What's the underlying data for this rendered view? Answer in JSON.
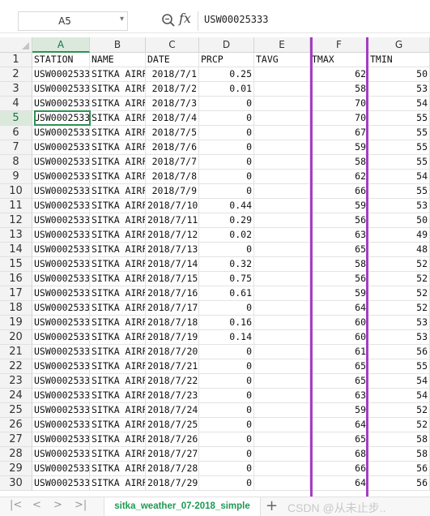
{
  "formula_bar": {
    "name_box": "A5",
    "fx_label": "fx",
    "content": "USW00025333"
  },
  "columns": [
    "A",
    "B",
    "C",
    "D",
    "E",
    "F",
    "G"
  ],
  "selected_column": "F",
  "rows": [
    {
      "n": "1",
      "A": "STATION",
      "B": "NAME",
      "C": "DATE",
      "D": "PRCP",
      "E": "TAVG",
      "F": "TMAX",
      "G": "TMIN"
    },
    {
      "n": "2",
      "A": "USW0002533",
      "B": "SITKA AIRF",
      "C": "2018/7/1",
      "D": "0.25",
      "E": "",
      "F": "62",
      "G": "50"
    },
    {
      "n": "3",
      "A": "USW0002533",
      "B": "SITKA AIRF",
      "C": "2018/7/2",
      "D": "0.01",
      "E": "",
      "F": "58",
      "G": "53"
    },
    {
      "n": "4",
      "A": "USW0002533",
      "B": "SITKA AIRF",
      "C": "2018/7/3",
      "D": "0",
      "E": "",
      "F": "70",
      "G": "54"
    },
    {
      "n": "5",
      "A": "USW0002533",
      "B": "SITKA AIRF",
      "C": "2018/7/4",
      "D": "0",
      "E": "",
      "F": "70",
      "G": "55"
    },
    {
      "n": "6",
      "A": "USW0002533",
      "B": "SITKA AIRF",
      "C": "2018/7/5",
      "D": "0",
      "E": "",
      "F": "67",
      "G": "55"
    },
    {
      "n": "7",
      "A": "USW0002533",
      "B": "SITKA AIRF",
      "C": "2018/7/6",
      "D": "0",
      "E": "",
      "F": "59",
      "G": "55"
    },
    {
      "n": "8",
      "A": "USW0002533",
      "B": "SITKA AIRF",
      "C": "2018/7/7",
      "D": "0",
      "E": "",
      "F": "58",
      "G": "55"
    },
    {
      "n": "9",
      "A": "USW0002533",
      "B": "SITKA AIRF",
      "C": "2018/7/8",
      "D": "0",
      "E": "",
      "F": "62",
      "G": "54"
    },
    {
      "n": "10",
      "A": "USW0002533",
      "B": "SITKA AIRF",
      "C": "2018/7/9",
      "D": "0",
      "E": "",
      "F": "66",
      "G": "55"
    },
    {
      "n": "11",
      "A": "USW0002533",
      "B": "SITKA AIRF",
      "C": "2018/7/10",
      "D": "0.44",
      "E": "",
      "F": "59",
      "G": "53"
    },
    {
      "n": "12",
      "A": "USW0002533",
      "B": "SITKA AIRF",
      "C": "2018/7/11",
      "D": "0.29",
      "E": "",
      "F": "56",
      "G": "50"
    },
    {
      "n": "13",
      "A": "USW0002533",
      "B": "SITKA AIRF",
      "C": "2018/7/12",
      "D": "0.02",
      "E": "",
      "F": "63",
      "G": "49"
    },
    {
      "n": "14",
      "A": "USW0002533",
      "B": "SITKA AIRF",
      "C": "2018/7/13",
      "D": "0",
      "E": "",
      "F": "65",
      "G": "48"
    },
    {
      "n": "15",
      "A": "USW0002533",
      "B": "SITKA AIRF",
      "C": "2018/7/14",
      "D": "0.32",
      "E": "",
      "F": "58",
      "G": "52"
    },
    {
      "n": "16",
      "A": "USW0002533",
      "B": "SITKA AIRF",
      "C": "2018/7/15",
      "D": "0.75",
      "E": "",
      "F": "56",
      "G": "52"
    },
    {
      "n": "17",
      "A": "USW0002533",
      "B": "SITKA AIRF",
      "C": "2018/7/16",
      "D": "0.61",
      "E": "",
      "F": "59",
      "G": "52"
    },
    {
      "n": "18",
      "A": "USW0002533",
      "B": "SITKA AIRF",
      "C": "2018/7/17",
      "D": "0",
      "E": "",
      "F": "64",
      "G": "52"
    },
    {
      "n": "19",
      "A": "USW0002533",
      "B": "SITKA AIRF",
      "C": "2018/7/18",
      "D": "0.16",
      "E": "",
      "F": "60",
      "G": "53"
    },
    {
      "n": "20",
      "A": "USW0002533",
      "B": "SITKA AIRF",
      "C": "2018/7/19",
      "D": "0.14",
      "E": "",
      "F": "60",
      "G": "53"
    },
    {
      "n": "21",
      "A": "USW0002533",
      "B": "SITKA AIRF",
      "C": "2018/7/20",
      "D": "0",
      "E": "",
      "F": "61",
      "G": "56"
    },
    {
      "n": "22",
      "A": "USW0002533",
      "B": "SITKA AIRF",
      "C": "2018/7/21",
      "D": "0",
      "E": "",
      "F": "65",
      "G": "55"
    },
    {
      "n": "23",
      "A": "USW0002533",
      "B": "SITKA AIRF",
      "C": "2018/7/22",
      "D": "0",
      "E": "",
      "F": "65",
      "G": "54"
    },
    {
      "n": "24",
      "A": "USW0002533",
      "B": "SITKA AIRF",
      "C": "2018/7/23",
      "D": "0",
      "E": "",
      "F": "63",
      "G": "54"
    },
    {
      "n": "25",
      "A": "USW0002533",
      "B": "SITKA AIRF",
      "C": "2018/7/24",
      "D": "0",
      "E": "",
      "F": "59",
      "G": "52"
    },
    {
      "n": "26",
      "A": "USW0002533",
      "B": "SITKA AIRF",
      "C": "2018/7/25",
      "D": "0",
      "E": "",
      "F": "64",
      "G": "52"
    },
    {
      "n": "27",
      "A": "USW0002533",
      "B": "SITKA AIRF",
      "C": "2018/7/26",
      "D": "0",
      "E": "",
      "F": "65",
      "G": "58"
    },
    {
      "n": "28",
      "A": "USW0002533",
      "B": "SITKA AIRF",
      "C": "2018/7/27",
      "D": "0",
      "E": "",
      "F": "68",
      "G": "58"
    },
    {
      "n": "29",
      "A": "USW0002533",
      "B": "SITKA AIRF",
      "C": "2018/7/28",
      "D": "0",
      "E": "",
      "F": "66",
      "G": "56"
    },
    {
      "n": "30",
      "A": "USW0002533",
      "B": "SITKA AIRF",
      "C": "2018/7/29",
      "D": "0",
      "E": "",
      "F": "64",
      "G": "56"
    }
  ],
  "sheet_tab": "sitka_weather_07-2018_simple",
  "add_sheet_label": "+",
  "watermark": "CSDN @从未止步..",
  "colors": {
    "selection_green": "#2e9153",
    "highlight_purple": "#a63cc2",
    "tab_text": "#1e9953"
  }
}
